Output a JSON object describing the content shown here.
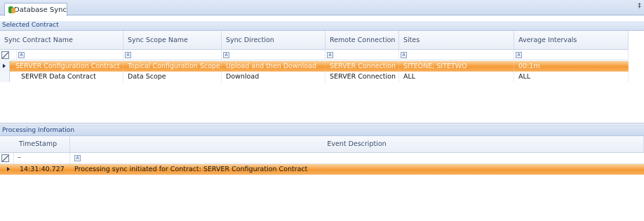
{
  "window": {
    "tab_title": "Database Sync",
    "pin_glyph": "‡"
  },
  "selected_contract": {
    "section_title": "Selected Contract",
    "columns": [
      "Sync Contract Name",
      "Sync Scope Name",
      "Sync Direction",
      "Remote Connection",
      "Sites",
      "Average Intervals"
    ],
    "filter_glyph": "A",
    "rows": [
      [
        "SERVER Configuration Contract",
        "Topical Configuration Scope",
        "Upload and then Download",
        "SERVER Connection",
        "SITEONE, SITETWO",
        "00:1m"
      ],
      [
        "SERVER Data Contract",
        "Data Scope",
        "Download",
        "SERVER Connection",
        "ALL",
        "ALL"
      ]
    ]
  },
  "processing": {
    "section_title": "Processing Information",
    "columns": [
      "TimeStamp",
      "Event Description"
    ],
    "filter_timestamp": "–",
    "filter_glyph": "A",
    "rows": [
      [
        "14:31:40.727",
        "Processing sync initiated for Contract: SERVER Configuration Contract"
      ]
    ]
  }
}
